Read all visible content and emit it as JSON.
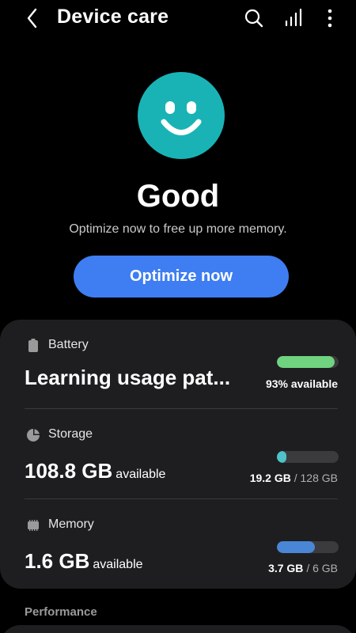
{
  "header": {
    "title": "Device care",
    "icons": [
      "back-arrow-icon",
      "search-icon",
      "signal-bars-icon",
      "more-vertical-icon"
    ]
  },
  "status": {
    "word": "Good",
    "description": "Optimize now to free up more memory.",
    "face_color": "#19b3b6",
    "icon": "smiley-face-icon"
  },
  "optimize": {
    "label": "Optimize now",
    "color": "#3e7ef2"
  },
  "battery": {
    "label": "Battery",
    "value": "Learning usage pat...",
    "detail": "93% available",
    "level_fraction": 0.93,
    "bar_color": "#6fd37f",
    "icon": "battery-icon"
  },
  "storage": {
    "label": "Storage",
    "value": "108.8 GB",
    "unit": "available",
    "used": "19.2 GB",
    "separator": "/",
    "total": "128 GB",
    "used_fraction": 0.15,
    "bar_color": "#4fc1c8",
    "icon": "pie-chart-icon"
  },
  "memory": {
    "label": "Memory",
    "value": "1.6 GB",
    "unit": "available",
    "used": "3.7 GB",
    "separator": "/",
    "total": "6 GB",
    "used_fraction": 0.62,
    "bar_color": "#4a86d6",
    "icon": "memory-chip-icon"
  },
  "performance": {
    "label": "Performance"
  }
}
